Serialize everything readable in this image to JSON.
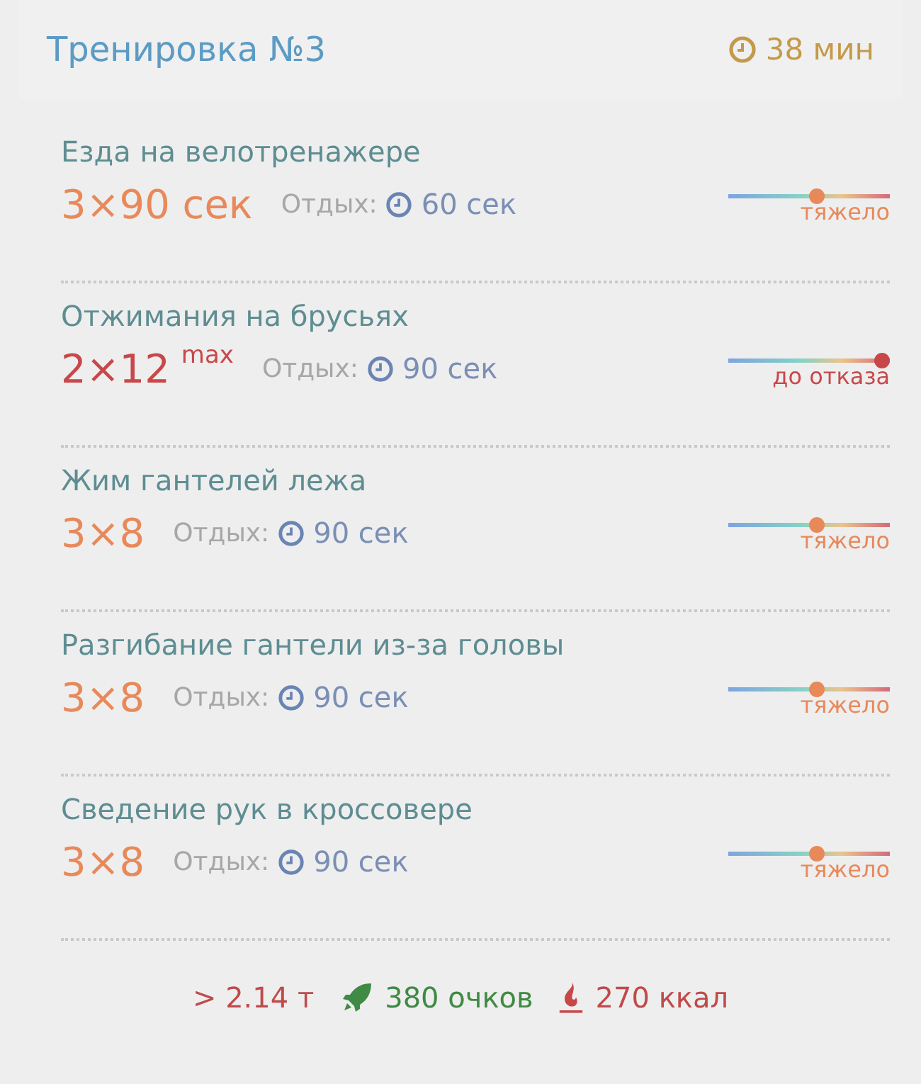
{
  "header": {
    "title": "Тренировка №3",
    "duration": "38 мин"
  },
  "exercises": [
    {
      "name": "Езда на велотренажере",
      "sets": "3×90 сек",
      "rest_label": "Отдых:",
      "rest": "60 сек",
      "level": 0.55,
      "intensity": "тяжело"
    },
    {
      "name": "Отжимания на брусьях",
      "sets": "2×12",
      "sets_suffix": "max",
      "rest_label": "Отдых:",
      "rest": "90 сек",
      "level": 1.0,
      "intensity": "до отказа"
    },
    {
      "name": "Жим гантелей лежа",
      "sets": "3×8",
      "rest_label": "Отдых:",
      "rest": "90 сек",
      "level": 0.55,
      "intensity": "тяжело"
    },
    {
      "name": "Разгибание гантели из-за головы",
      "sets": "3×8",
      "rest_label": "Отдых:",
      "rest": "90 сек",
      "level": 0.55,
      "intensity": "тяжело"
    },
    {
      "name": "Сведение рук в кроссовере",
      "sets": "3×8",
      "rest_label": "Отдых:",
      "rest": "90 сек",
      "level": 0.55,
      "intensity": "тяжело"
    }
  ],
  "summary": {
    "weight": "> 2.14 т",
    "points": "380 очков",
    "calories": "270 ккал"
  }
}
